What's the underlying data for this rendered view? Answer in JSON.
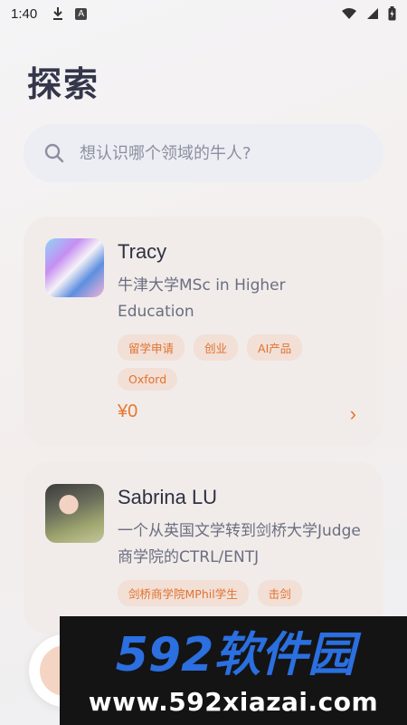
{
  "status_bar": {
    "time": "1:40",
    "left_icons": [
      "download-icon",
      "a-box-icon"
    ],
    "right_icons": [
      "wifi-icon",
      "signal-icon",
      "battery-icon"
    ]
  },
  "page": {
    "title": "探索"
  },
  "search": {
    "placeholder": "想认识哪个领域的牛人?"
  },
  "cards": [
    {
      "name": "Tracy",
      "description": "牛津大学MSc in Higher Education",
      "tags": [
        "留学申请",
        "创业",
        "AI产品",
        "Oxford"
      ],
      "price": "¥0",
      "arrow": "›"
    },
    {
      "name": "Sabrina LU",
      "description": "一个从英国文学转到剑桥大学Judge商学院的CTRL/ENTJ",
      "tags": [
        "剑桥商学院MPhil学生",
        "击剑"
      ]
    }
  ],
  "watermark": {
    "logo_text": "592软件园",
    "url": "www.592xiazai.com"
  },
  "colors": {
    "accent": "#e8772f",
    "tag_bg": "#f2dfd6",
    "card_bg": "#f1ecea",
    "title": "#34364a"
  }
}
